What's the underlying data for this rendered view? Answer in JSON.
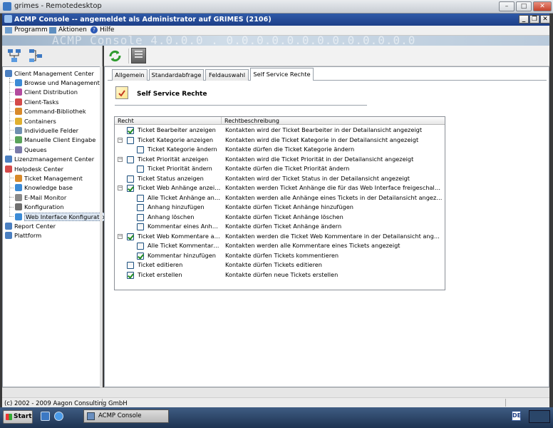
{
  "remote": {
    "title": "grimes - Remotedesktop"
  },
  "app": {
    "title": "ACMP Console -- angemeldet als Administrator auf GRIMES (2106)",
    "banner_text": "ACMP Console 4.0.0.0 . 0.0.0.0.0.0.0.0.0.0.0.0.0",
    "menu": [
      "Programm",
      "Aktionen",
      "Hilfe"
    ]
  },
  "tree": {
    "items": [
      {
        "label": "Client Management Center",
        "level": 0,
        "icon": "globe-icon",
        "color": "#4a7fc1"
      },
      {
        "label": "Browse und Management",
        "level": 1,
        "icon": "search-icon",
        "color": "#3c8bd6"
      },
      {
        "label": "Client Distribution",
        "level": 1,
        "icon": "distribution-icon",
        "color": "#b34b9e"
      },
      {
        "label": "Client-Tasks",
        "level": 1,
        "icon": "tasks-icon",
        "color": "#d44a4a"
      },
      {
        "label": "Command-Bibliothek",
        "level": 1,
        "icon": "library-icon",
        "color": "#d88a2b"
      },
      {
        "label": "Containers",
        "level": 1,
        "icon": "container-icon",
        "color": "#e0b030"
      },
      {
        "label": "Individuelle Felder",
        "level": 1,
        "icon": "fields-icon",
        "color": "#6f8fb0"
      },
      {
        "label": "Manuelle Client Eingabe",
        "level": 1,
        "icon": "client-icon",
        "color": "#5aa35a"
      },
      {
        "label": "Queues",
        "level": 1,
        "icon": "queue-icon",
        "color": "#7a7aa8"
      },
      {
        "label": "Lizenzmanagement Center",
        "level": 0,
        "icon": "license-icon",
        "color": "#4a7fc1"
      },
      {
        "label": "Helpdesk Center",
        "level": 0,
        "icon": "helpdesk-icon",
        "color": "#d44a4a"
      },
      {
        "label": "Ticket Management",
        "level": 1,
        "icon": "ticket-icon",
        "color": "#d88a2b"
      },
      {
        "label": "Knowledge base",
        "level": 1,
        "icon": "book-icon",
        "color": "#3c8bd6"
      },
      {
        "label": "E-Mail Monitor",
        "level": 1,
        "icon": "mail-icon",
        "color": "#8a8a8a"
      },
      {
        "label": "Konfiguration",
        "level": 1,
        "icon": "gear-icon",
        "color": "#6f6f6f"
      },
      {
        "label": "Web Interface Konfiguration",
        "level": 1,
        "icon": "web-gear-icon",
        "color": "#3c8bd6",
        "selected": true
      },
      {
        "label": "Report Center",
        "level": 0,
        "icon": "report-icon",
        "color": "#4a7fc1"
      },
      {
        "label": "Plattform",
        "level": 0,
        "icon": "platform-icon",
        "color": "#4a7fc1"
      }
    ]
  },
  "tabs": [
    "Allgemein",
    "Standardabfrage",
    "Feldauswahl",
    "Self Service Rechte"
  ],
  "section": {
    "title": "Self Service Rechte"
  },
  "table": {
    "headers": [
      "Recht",
      "Rechtbeschreibung"
    ],
    "rows": [
      {
        "name": "Ticket Bearbeiter anzeigen",
        "desc": "Kontakten wird der Ticket Bearbeiter in der Detailansicht angezeigt",
        "checked": true,
        "indent": 0,
        "expander": false
      },
      {
        "name": "Ticket Kategorie anzeigen",
        "desc": "Kontakten wird die Ticket Kategorie in der Detailansicht angezeigt",
        "checked": false,
        "indent": 0,
        "expander": true
      },
      {
        "name": "Ticket Kategorie ändern",
        "desc": "Kontakte dürfen die Ticket Kategorie ändern",
        "checked": false,
        "indent": 1,
        "expander": false
      },
      {
        "name": "Ticket Priorität anzeigen",
        "desc": "Kontakten wird die Ticket Priorität in der Detailansicht angezeigt",
        "checked": false,
        "indent": 0,
        "expander": true
      },
      {
        "name": "Ticket Priorität ändern",
        "desc": "Kontakte dürfen die Ticket Priorität ändern",
        "checked": false,
        "indent": 1,
        "expander": false
      },
      {
        "name": "Ticket Status anzeigen",
        "desc": "Kontakten wird der Ticket Status in der Detailansicht angezeigt",
        "checked": false,
        "indent": 0,
        "expander": false
      },
      {
        "name": "Ticket Web Anhänge anzeigen",
        "desc": "Kontakten werden Ticket Anhänge die für das Web Interface freigeschaltet wurde...",
        "checked": true,
        "indent": 0,
        "expander": true
      },
      {
        "name": "Alle Ticket Anhänge anzei...",
        "desc": "Kontakten werden alle Anhänge eines Tickets in der Detailansicht angezeigt",
        "checked": false,
        "indent": 1,
        "expander": false
      },
      {
        "name": "Anhang hinzufügen",
        "desc": "Kontakte dürfen Ticket Anhänge hinzufügen",
        "checked": false,
        "indent": 1,
        "expander": false
      },
      {
        "name": "Anhang löschen",
        "desc": "Kontakte dürfen Ticket Anhänge löschen",
        "checked": false,
        "indent": 1,
        "expander": false
      },
      {
        "name": "Kommentar eines Anhang...",
        "desc": "Kontakte dürfen Ticket Anhänge ändern",
        "checked": false,
        "indent": 1,
        "expander": false
      },
      {
        "name": "Ticket Web Kommentare anz...",
        "desc": "Kontakten werden die Ticket Web Kommentare in der Detailansicht angezeigt",
        "checked": true,
        "indent": 0,
        "expander": true
      },
      {
        "name": "Alle Ticket Kommentare a...",
        "desc": "Kontakten werden alle Kommentare eines Tickets angezeigt",
        "checked": false,
        "indent": 1,
        "expander": false
      },
      {
        "name": "Kommentar hinzufügen",
        "desc": "Kontakte dürfen Tickets kommentieren",
        "checked": true,
        "indent": 1,
        "expander": false
      },
      {
        "name": "Ticket editieren",
        "desc": "Kontakte dürfen Tickets editieren",
        "checked": false,
        "indent": 0,
        "expander": false
      },
      {
        "name": "Ticket erstellen",
        "desc": "Kontakte dürfen neue Tickets erstellen",
        "checked": true,
        "indent": 0,
        "expander": false
      }
    ]
  },
  "status": {
    "text": "(c) 2002 - 2009 Aagon Consulting GmbH"
  },
  "taskbar": {
    "start": "Start",
    "task": "ACMP Console",
    "lang": "DE"
  },
  "colors": {
    "app_title_bg": "#2f5aa8",
    "taskbar_bg": "#1d3351",
    "check": "#1f8c1f"
  }
}
